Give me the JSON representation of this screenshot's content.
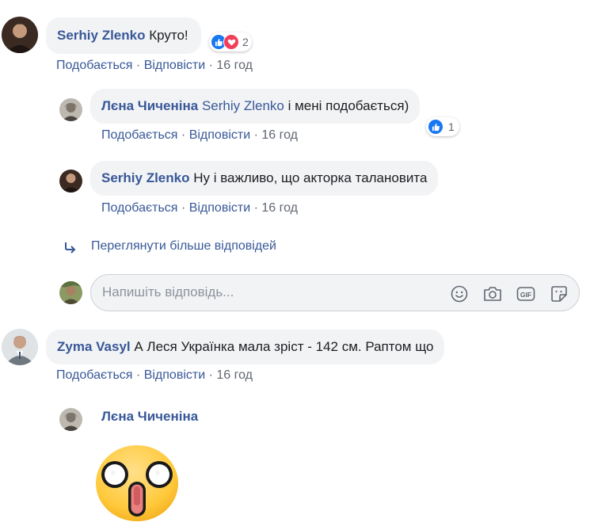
{
  "comments": [
    {
      "author": "Serhiy Zlenko",
      "text": "Круто!",
      "reaction_count": "2",
      "actions": {
        "like": "Подобається",
        "reply": "Відповісти",
        "time": "16 год"
      }
    },
    {
      "author": "Zyma Vasyl",
      "text": "А Леся Українка мала зріст - 142 см. Раптом що",
      "actions": {
        "like": "Подобається",
        "reply": "Відповісти",
        "time": "16 год"
      }
    }
  ],
  "replies": [
    {
      "author": "Лєна Чиченіна",
      "mention": "Serhiy Zlenko",
      "text": "і мені подобається)",
      "reaction_count": "1",
      "actions": {
        "like": "Подобається",
        "reply": "Відповісти",
        "time": "16 год"
      }
    },
    {
      "author": "Serhiy Zlenko",
      "text": "Ну і важливо, що акторка талановита",
      "actions": {
        "like": "Подобається",
        "reply": "Відповісти",
        "time": "16 год"
      }
    },
    {
      "author": "Лєна Чиченіна",
      "sticker": "shocked-face-sticker"
    }
  ],
  "view_more": "Переглянути більше відповідей",
  "reply_box": {
    "placeholder": "Напишіть відповідь..."
  },
  "separator": "·",
  "colors": {
    "link": "#385898",
    "bubble": "#f2f3f5",
    "like": "#1877f2",
    "love": "#f33e58",
    "muted": "#606770"
  },
  "icons": [
    "like-icon",
    "love-icon",
    "reply-arrow-icon",
    "emoji-icon",
    "camera-icon",
    "gif-icon",
    "sticker-icon"
  ]
}
